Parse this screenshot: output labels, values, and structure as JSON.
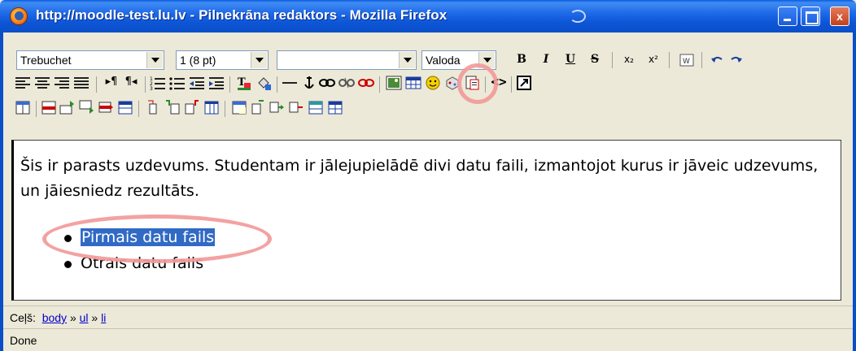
{
  "window": {
    "title": "http://moodle-test.lu.lv - Pilnekrāna redaktors - Mozilla Firefox",
    "minimize_label": "",
    "maximize_label": "",
    "close_label": "x"
  },
  "toolbar": {
    "font_family": "Trebuchet",
    "font_size": "1 (8 pt)",
    "style_value": "",
    "language": "Valoda",
    "bold": "B",
    "italic": "I",
    "underline": "U",
    "strike": "S",
    "subscript": "x₂",
    "superscript": "x²"
  },
  "editor": {
    "paragraph": "Šis ir parasts uzdevums. Studentam ir jālejupielādē divi datu faili, izmantojot kurus ir jāveic udzevums, un jāiesniedz rezultāts.",
    "items": [
      {
        "label": "Pirmais datu fails",
        "selected": true
      },
      {
        "label": "Otrais datu fails",
        "selected": false
      }
    ]
  },
  "pathbar": {
    "label": "Ceļš:",
    "crumbs": [
      "body",
      "ul",
      "li"
    ],
    "separator": "»"
  },
  "status": {
    "text": "Done"
  },
  "colors": {
    "titlebar": "#0b4fc8",
    "selection": "#316ac5",
    "annotation_ring": "#f29a9a"
  }
}
